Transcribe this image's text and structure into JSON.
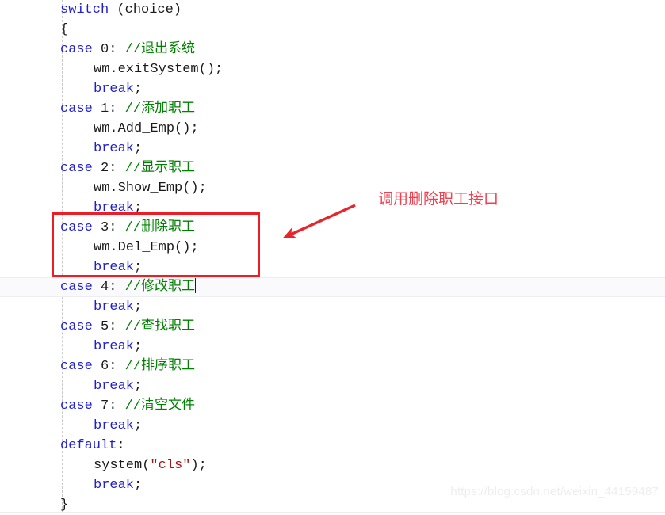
{
  "editor": {
    "language": "cpp",
    "theme_colors": {
      "background": "#ffffff",
      "keyword": "#1f1fd0",
      "comment": "#008000",
      "string": "#a31515",
      "plain": "#1a1a1a",
      "indent_guide": "#c9c9c9",
      "active_line": "#fafafc"
    },
    "active_line_number": 15,
    "code_lines": [
      {
        "indent": 0,
        "tokens": [
          {
            "t": "switch",
            "c": "kw"
          },
          {
            "t": " (choice)",
            "c": "punc"
          }
        ]
      },
      {
        "indent": 0,
        "tokens": [
          {
            "t": "{",
            "c": "punc"
          }
        ]
      },
      {
        "indent": 0,
        "tokens": [
          {
            "t": "case",
            "c": "kw"
          },
          {
            "t": " 0: ",
            "c": "num"
          },
          {
            "t": "//退出系统",
            "c": "cmt"
          }
        ]
      },
      {
        "indent": 1,
        "tokens": [
          {
            "t": "wm.exitSystem();",
            "c": "fn"
          }
        ]
      },
      {
        "indent": 1,
        "tokens": [
          {
            "t": "break",
            "c": "kw"
          },
          {
            "t": ";",
            "c": "punc"
          }
        ]
      },
      {
        "indent": 0,
        "tokens": [
          {
            "t": "case",
            "c": "kw"
          },
          {
            "t": " 1: ",
            "c": "num"
          },
          {
            "t": "//添加职工",
            "c": "cmt"
          }
        ]
      },
      {
        "indent": 1,
        "tokens": [
          {
            "t": "wm.Add_Emp();",
            "c": "fn"
          }
        ]
      },
      {
        "indent": 1,
        "tokens": [
          {
            "t": "break",
            "c": "kw"
          },
          {
            "t": ";",
            "c": "punc"
          }
        ]
      },
      {
        "indent": 0,
        "tokens": [
          {
            "t": "case",
            "c": "kw"
          },
          {
            "t": " 2: ",
            "c": "num"
          },
          {
            "t": "//显示职工",
            "c": "cmt"
          }
        ]
      },
      {
        "indent": 1,
        "tokens": [
          {
            "t": "wm.Show_Emp();",
            "c": "fn"
          }
        ]
      },
      {
        "indent": 1,
        "tokens": [
          {
            "t": "break",
            "c": "kw"
          },
          {
            "t": ";",
            "c": "punc"
          }
        ]
      },
      {
        "indent": 0,
        "tokens": [
          {
            "t": "case",
            "c": "kw"
          },
          {
            "t": " 3: ",
            "c": "num"
          },
          {
            "t": "//删除职工",
            "c": "cmt"
          }
        ]
      },
      {
        "indent": 1,
        "tokens": [
          {
            "t": "wm.Del_Emp();",
            "c": "fn"
          }
        ]
      },
      {
        "indent": 1,
        "tokens": [
          {
            "t": "break",
            "c": "kw"
          },
          {
            "t": ";",
            "c": "punc"
          }
        ]
      },
      {
        "indent": 0,
        "caret": true,
        "tokens": [
          {
            "t": "case",
            "c": "kw"
          },
          {
            "t": " 4: ",
            "c": "num"
          },
          {
            "t": "//修改职工",
            "c": "cmt"
          }
        ]
      },
      {
        "indent": 1,
        "tokens": [
          {
            "t": "break",
            "c": "kw"
          },
          {
            "t": ";",
            "c": "punc"
          }
        ]
      },
      {
        "indent": 0,
        "tokens": [
          {
            "t": "case",
            "c": "kw"
          },
          {
            "t": " 5: ",
            "c": "num"
          },
          {
            "t": "//查找职工",
            "c": "cmt"
          }
        ]
      },
      {
        "indent": 1,
        "tokens": [
          {
            "t": "break",
            "c": "kw"
          },
          {
            "t": ";",
            "c": "punc"
          }
        ]
      },
      {
        "indent": 0,
        "tokens": [
          {
            "t": "case",
            "c": "kw"
          },
          {
            "t": " 6: ",
            "c": "num"
          },
          {
            "t": "//排序职工",
            "c": "cmt"
          }
        ]
      },
      {
        "indent": 1,
        "tokens": [
          {
            "t": "break",
            "c": "kw"
          },
          {
            "t": ";",
            "c": "punc"
          }
        ]
      },
      {
        "indent": 0,
        "tokens": [
          {
            "t": "case",
            "c": "kw"
          },
          {
            "t": " 7: ",
            "c": "num"
          },
          {
            "t": "//清空文件",
            "c": "cmt"
          }
        ]
      },
      {
        "indent": 1,
        "tokens": [
          {
            "t": "break",
            "c": "kw"
          },
          {
            "t": ";",
            "c": "punc"
          }
        ]
      },
      {
        "indent": 0,
        "tokens": [
          {
            "t": "default",
            "c": "kw"
          },
          {
            "t": ":",
            "c": "punc"
          }
        ]
      },
      {
        "indent": 1,
        "tokens": [
          {
            "t": "system(",
            "c": "fn"
          },
          {
            "t": "\"cls\"",
            "c": "str"
          },
          {
            "t": ");",
            "c": "fn"
          }
        ]
      },
      {
        "indent": 1,
        "tokens": [
          {
            "t": "break",
            "c": "kw"
          },
          {
            "t": ";",
            "c": "punc"
          }
        ]
      },
      {
        "indent": 0,
        "tokens": [
          {
            "t": "}",
            "c": "punc"
          }
        ]
      }
    ]
  },
  "annotations": {
    "label_text": "调用删除职工接口",
    "label_color": "#ef4050",
    "box_color": "#ee1c25",
    "arrow_color": "#e8252c",
    "highlighted_code": "case 3: //删除职工 / wm.Del_Emp(); / break;"
  },
  "watermark": {
    "text": "https://blog.csdn.net/weixin_44159487",
    "color": "#eeeeee"
  }
}
